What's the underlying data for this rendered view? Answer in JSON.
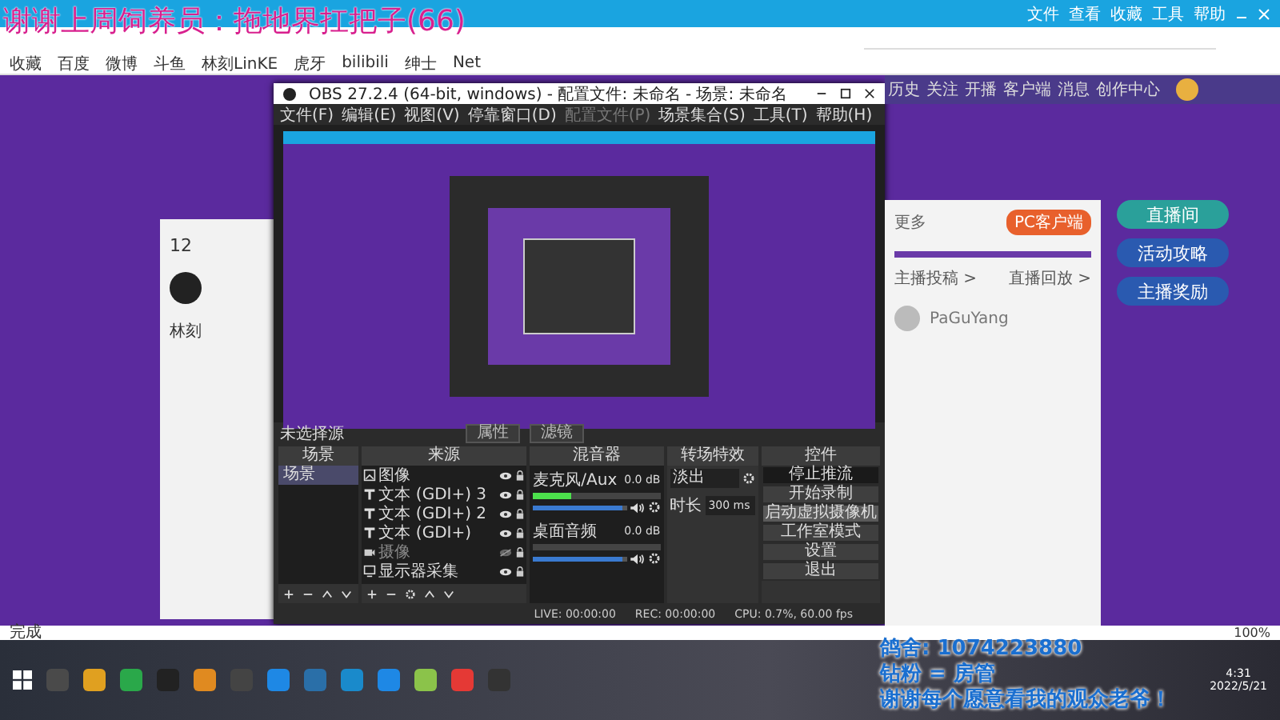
{
  "browser": {
    "overlay_title": "谢谢上周饲养员：拖地界扛把子(66)",
    "menu": [
      "文件",
      "查看",
      "收藏",
      "工具",
      "帮助"
    ],
    "bookmarks": [
      "收藏",
      "百度",
      "微博",
      "斗鱼",
      "林刻LinKE",
      "虎牙",
      "bilibili",
      "绅士",
      "Net"
    ],
    "status": "完成",
    "zoom": "100%"
  },
  "site": {
    "nav": [
      "历史",
      "关注",
      "开播",
      "客户端",
      "消息",
      "创作中心"
    ],
    "left_card": {
      "count": "12",
      "name": "林刻"
    },
    "side_buttons": [
      "直播间",
      "活动攻略",
      "主播奖励"
    ],
    "card": {
      "more": "更多",
      "client_button": "PC客户端",
      "links": [
        "主播投稿 >",
        "直播回放 >"
      ],
      "ranking": [
        {
          "name": "PaGuYang"
        }
      ]
    }
  },
  "obs": {
    "title": "OBS 27.2.4 (64-bit, windows) - 配置文件: 未命名 - 场景: 未命名",
    "menu": [
      {
        "label": "文件(F)",
        "disabled": false
      },
      {
        "label": "编辑(E)",
        "disabled": false
      },
      {
        "label": "视图(V)",
        "disabled": false
      },
      {
        "label": "停靠窗口(D)",
        "disabled": false
      },
      {
        "label": "配置文件(P)",
        "disabled": true
      },
      {
        "label": "场景集合(S)",
        "disabled": false
      },
      {
        "label": "工具(T)",
        "disabled": false
      },
      {
        "label": "帮助(H)",
        "disabled": false
      }
    ],
    "no_source": "未选择源",
    "source_buttons": [
      "属性",
      "滤镜"
    ],
    "scenes": {
      "title": "场景",
      "items": [
        {
          "name": "场景",
          "selected": true
        }
      ]
    },
    "sources": {
      "title": "来源",
      "items": [
        {
          "kind": "image",
          "name": "图像",
          "visible": true
        },
        {
          "kind": "text",
          "name": "文本 (GDI+) 3",
          "visible": true
        },
        {
          "kind": "text",
          "name": "文本 (GDI+) 2",
          "visible": true
        },
        {
          "kind": "text",
          "name": "文本 (GDI+)",
          "visible": true
        },
        {
          "kind": "camera",
          "name": "摄像",
          "visible": false
        },
        {
          "kind": "display",
          "name": "显示器采集",
          "visible": true
        }
      ]
    },
    "mixer": {
      "title": "混音器",
      "channels": [
        {
          "name": "麦克风/Aux",
          "reading": "0.0 dB",
          "level": 0.3,
          "fader": {
            "level": 0.95
          }
        },
        {
          "name": "桌面音频",
          "reading": "0.0 dB",
          "fader": {
            "level": 0.95
          }
        }
      ]
    },
    "transitions": {
      "title": "转场特效",
      "type": "淡出",
      "duration_label": "时长",
      "duration": "300 ms"
    },
    "controls": {
      "title": "控件",
      "buttons": [
        {
          "label": "停止推流",
          "active": true,
          "hovered": false
        },
        {
          "label": "开始录制",
          "active": false,
          "hovered": false
        },
        {
          "label": "启动虚拟摄像机",
          "active": false,
          "hovered": true
        },
        {
          "label": "工作室模式",
          "active": false,
          "hovered": false
        },
        {
          "label": "设置",
          "active": false,
          "hovered": false
        },
        {
          "label": "退出",
          "active": false,
          "hovered": false
        }
      ]
    },
    "status": {
      "live": "LIVE: 00:00:00",
      "rec": "REC: 00:00:00",
      "cpu": "CPU: 0.7%, 60.00 fps"
    }
  },
  "overlay": {
    "lines": [
      "鸽舍: 1074223880",
      "钻粉 = 房管",
      "谢谢每个愿意看我的观众老爷！"
    ]
  },
  "taskbar": {
    "time": "4:31",
    "date": "2022/5/21"
  }
}
